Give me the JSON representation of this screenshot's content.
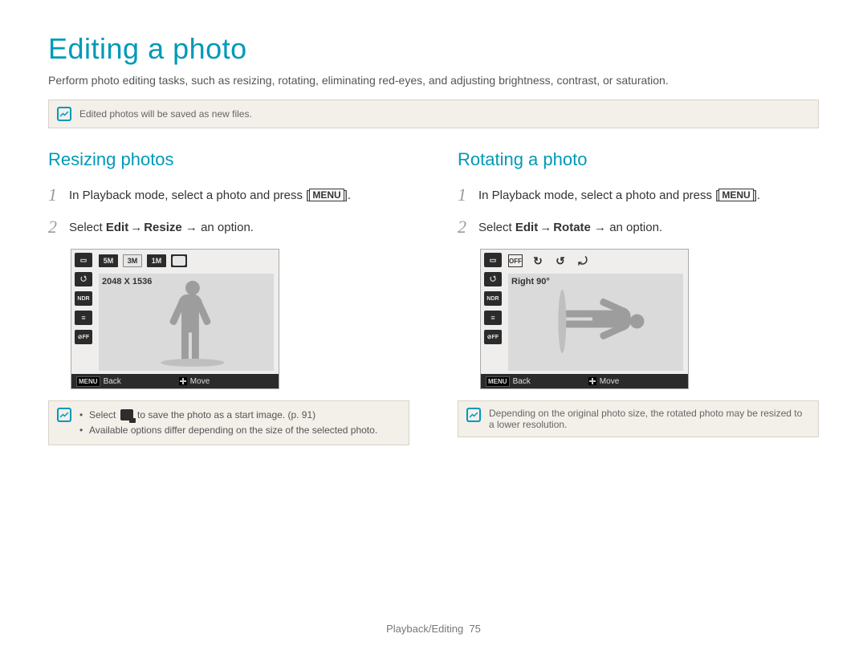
{
  "title": "Editing a photo",
  "intro": "Perform photo editing tasks, such as resizing, rotating, eliminating red-eyes, and adjusting brightness, contrast, or saturation.",
  "top_note": "Edited photos will be saved as new files.",
  "left": {
    "heading": "Resizing photos",
    "step1_num": "1",
    "step1_a": "In Playback mode, select a photo and press [",
    "step1_menu": "MENU",
    "step1_b": "].",
    "step2_num": "2",
    "step2_a": "Select ",
    "step2_b": "Edit",
    "step2_c": " → ",
    "step2_d": "Resize",
    "step2_e": " → an option.",
    "lcd": {
      "chips": {
        "a": "5M",
        "b": "3M",
        "c": "1M"
      },
      "caption": "2048 X 1536",
      "back": "Back",
      "move": "Move"
    },
    "note1_a": "Select ",
    "note1_b": " to save the photo as a start image. (p. 91)",
    "note2": "Available options differ depending on the size of the selected photo."
  },
  "right": {
    "heading": "Rotating a photo",
    "step1_num": "1",
    "step1_a": "In Playback mode, select a photo and press [",
    "step1_menu": "MENU",
    "step1_b": "].",
    "step2_num": "2",
    "step2_a": "Select ",
    "step2_b": "Edit",
    "step2_c": " → ",
    "step2_d": "Rotate",
    "step2_e": " → an option.",
    "lcd": {
      "caption": "Right 90°",
      "back": "Back",
      "move": "Move"
    },
    "note": "Depending on the original photo size, the rotated photo may be resized to a lower resolution."
  },
  "footer": {
    "section": "Playback/Editing",
    "page": "75"
  }
}
